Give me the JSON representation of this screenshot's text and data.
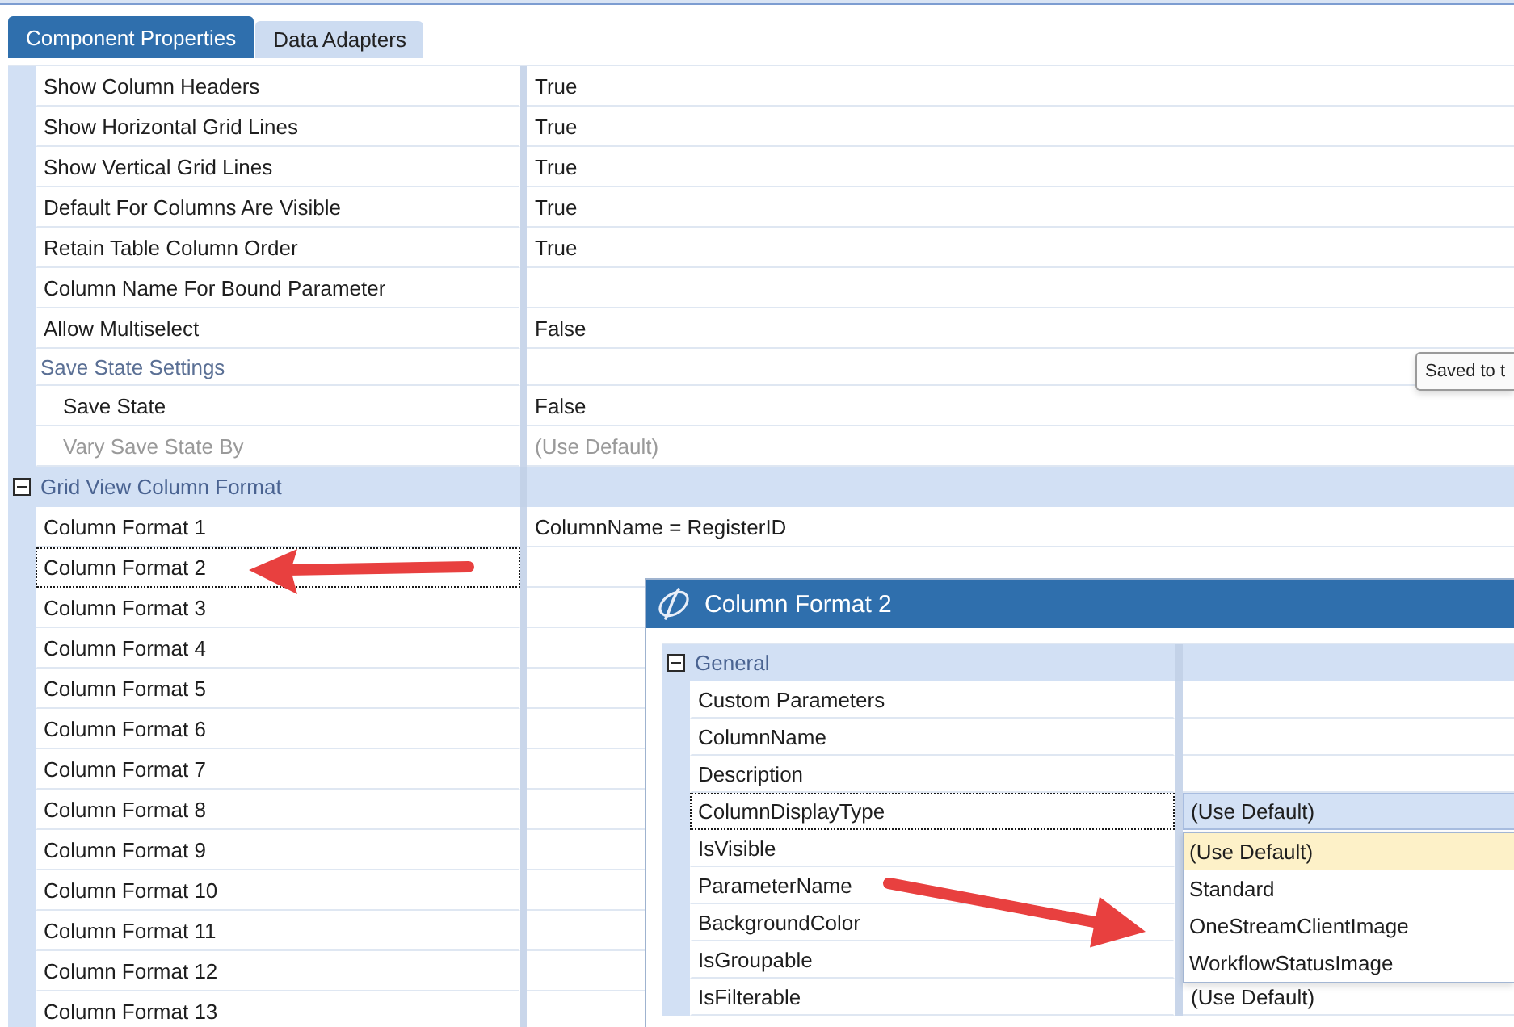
{
  "tabs": [
    {
      "label": "Component Properties",
      "selected": true
    },
    {
      "label": "Data Adapters",
      "selected": false
    }
  ],
  "property_grid": {
    "rows": [
      {
        "kind": "property",
        "name": "Show Column Headers",
        "value": "True",
        "selected": false,
        "disabled": false
      },
      {
        "kind": "property",
        "name": "Show Horizontal Grid Lines",
        "value": "True",
        "selected": false,
        "disabled": false
      },
      {
        "kind": "property",
        "name": "Show Vertical Grid Lines",
        "value": "True",
        "selected": false,
        "disabled": false
      },
      {
        "kind": "property",
        "name": "Default For Columns Are Visible",
        "value": "True",
        "selected": false,
        "disabled": false
      },
      {
        "kind": "property",
        "name": "Retain Table Column Order",
        "value": "True",
        "selected": false,
        "disabled": false
      },
      {
        "kind": "property",
        "name": "Column Name For Bound Parameter",
        "selected": false,
        "disabled": false
      },
      {
        "kind": "property",
        "name": "Allow Multiselect",
        "value": "False",
        "selected": false,
        "disabled": false
      },
      {
        "kind": "group",
        "name": "Save State Settings",
        "selected": false,
        "disabled": false,
        "children": [
          {
            "kind": "property",
            "name": "Save State",
            "value": "False",
            "selected": false,
            "disabled": false
          },
          {
            "kind": "property",
            "name": "Vary Save State By",
            "value": "(Use Default)",
            "selected": false,
            "disabled": true
          }
        ]
      },
      {
        "kind": "category",
        "name": "Grid View Column Format",
        "expanded": true,
        "selected": false,
        "disabled": false,
        "children": [
          {
            "kind": "property",
            "name": "Column Format 1",
            "value": "ColumnName = RegisterID",
            "selected": false,
            "disabled": false
          },
          {
            "kind": "property",
            "name": "Column Format 2",
            "selected": true,
            "disabled": false
          },
          {
            "kind": "property",
            "name": "Column Format 3",
            "selected": false,
            "disabled": false
          },
          {
            "kind": "property",
            "name": "Column Format 4",
            "selected": false,
            "disabled": false
          },
          {
            "kind": "property",
            "name": "Column Format 5",
            "selected": false,
            "disabled": false
          },
          {
            "kind": "property",
            "name": "Column Format 6",
            "selected": false,
            "disabled": false
          },
          {
            "kind": "property",
            "name": "Column Format 7",
            "selected": false,
            "disabled": false
          },
          {
            "kind": "property",
            "name": "Column Format 8",
            "selected": false,
            "disabled": false
          },
          {
            "kind": "property",
            "name": "Column Format 9",
            "selected": false,
            "disabled": false
          },
          {
            "kind": "property",
            "name": "Column Format 10",
            "selected": false,
            "disabled": false
          },
          {
            "kind": "property",
            "name": "Column Format 11",
            "selected": false,
            "disabled": false
          },
          {
            "kind": "property",
            "name": "Column Format 12",
            "selected": false,
            "disabled": false
          },
          {
            "kind": "property",
            "name": "Column Format 13",
            "selected": false,
            "disabled": false
          }
        ]
      }
    ]
  },
  "tooltip": {
    "text": "Saved to t"
  },
  "dialog": {
    "title": "Column Format 2",
    "rows": [
      {
        "kind": "category",
        "name": "General",
        "expanded": true,
        "selected": false,
        "children": [
          {
            "kind": "property",
            "name": "Custom Parameters",
            "selected": false
          },
          {
            "kind": "property",
            "name": "ColumnName",
            "selected": false
          },
          {
            "kind": "property",
            "name": "Description",
            "selected": false
          },
          {
            "kind": "dropdown",
            "name": "ColumnDisplayType",
            "value": "(Use Default)",
            "selected": true,
            "expanded": true,
            "options": [
              {
                "label": "(Use Default)",
                "selected": true
              },
              {
                "label": "Standard",
                "selected": false
              },
              {
                "label": "OneStreamClientImage",
                "selected": false
              },
              {
                "label": "WorkflowStatusImage",
                "selected": false
              }
            ]
          },
          {
            "kind": "property",
            "name": "IsVisible",
            "selected": false
          },
          {
            "kind": "property",
            "name": "ParameterName",
            "selected": false
          },
          {
            "kind": "property",
            "name": "BackgroundColor",
            "selected": false
          },
          {
            "kind": "property",
            "name": "IsGroupable",
            "selected": false
          },
          {
            "kind": "property",
            "name": "IsFilterable",
            "value": "(Use Default)",
            "selected": false
          }
        ]
      }
    ]
  }
}
